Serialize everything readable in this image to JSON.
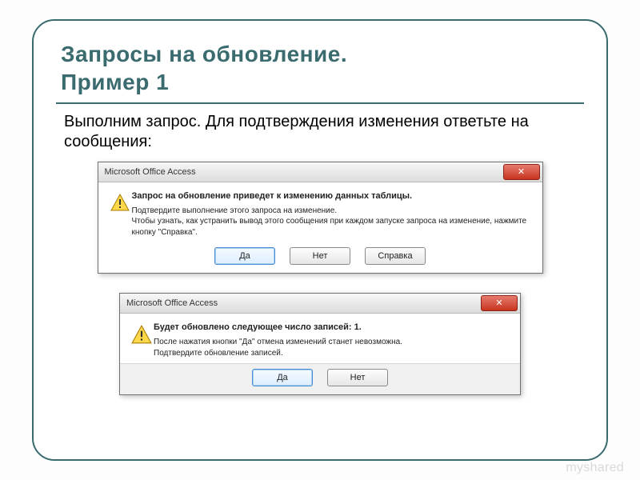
{
  "slide": {
    "title_line1": "Запросы на обновление.",
    "title_line2": "Пример 1",
    "lead": "Выполним запрос. Для подтверждения изменения ответьте на сообщения:"
  },
  "dialog1": {
    "app_title": "Microsoft Office Access",
    "close_glyph": "✕",
    "headline": "Запрос на обновление приведет к изменению данных таблицы.",
    "line1": "Подтвердите выполнение этого запроса на изменение.",
    "line2": "Чтобы узнать, как устранить вывод этого сообщения при каждом запуске запроса на изменение, нажмите кнопку \"Справка\".",
    "btn_yes": "Да",
    "btn_no": "Нет",
    "btn_help": "Справка"
  },
  "dialog2": {
    "app_title": "Microsoft Office Access",
    "close_glyph": "✕",
    "headline": "Будет обновлено следующее число записей: 1.",
    "line1": "После нажатия кнопки \"Да\" отмена изменений станет невозможна.",
    "line2": "Подтвердите обновление записей.",
    "btn_yes": "Да",
    "btn_no": "Нет"
  },
  "watermark": "myshared"
}
